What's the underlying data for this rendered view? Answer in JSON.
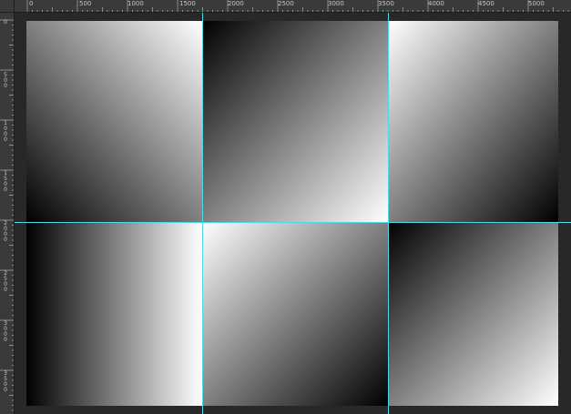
{
  "ruler": {
    "horizontal_labels": [
      "0",
      "500",
      "1000",
      "1500",
      "2000",
      "2500",
      "3000",
      "3500",
      "4000",
      "4500",
      "5000"
    ],
    "vertical_labels": [
      "0",
      "500",
      "1000",
      "1500",
      "2000",
      "2500",
      "3000",
      "3500"
    ]
  },
  "canvas": {
    "tiles": [
      {
        "name": "gradient-tile-top-left",
        "gradient": "white top-right to black bottom-left"
      },
      {
        "name": "gradient-tile-top-center",
        "gradient": "black top-left to white bottom-right"
      },
      {
        "name": "gradient-tile-top-right",
        "gradient": "white top-left to black bottom-right"
      },
      {
        "name": "gradient-tile-bottom-left",
        "gradient": "black left to white right"
      },
      {
        "name": "gradient-tile-bottom-center",
        "gradient": "white top-left to black bottom-right"
      },
      {
        "name": "gradient-tile-bottom-right",
        "gradient": "black top-left to white bottom-right"
      }
    ]
  },
  "colors": {
    "workspace": "#282828",
    "ruler": "#3a3a3a",
    "guide": "#4fd8e8"
  }
}
